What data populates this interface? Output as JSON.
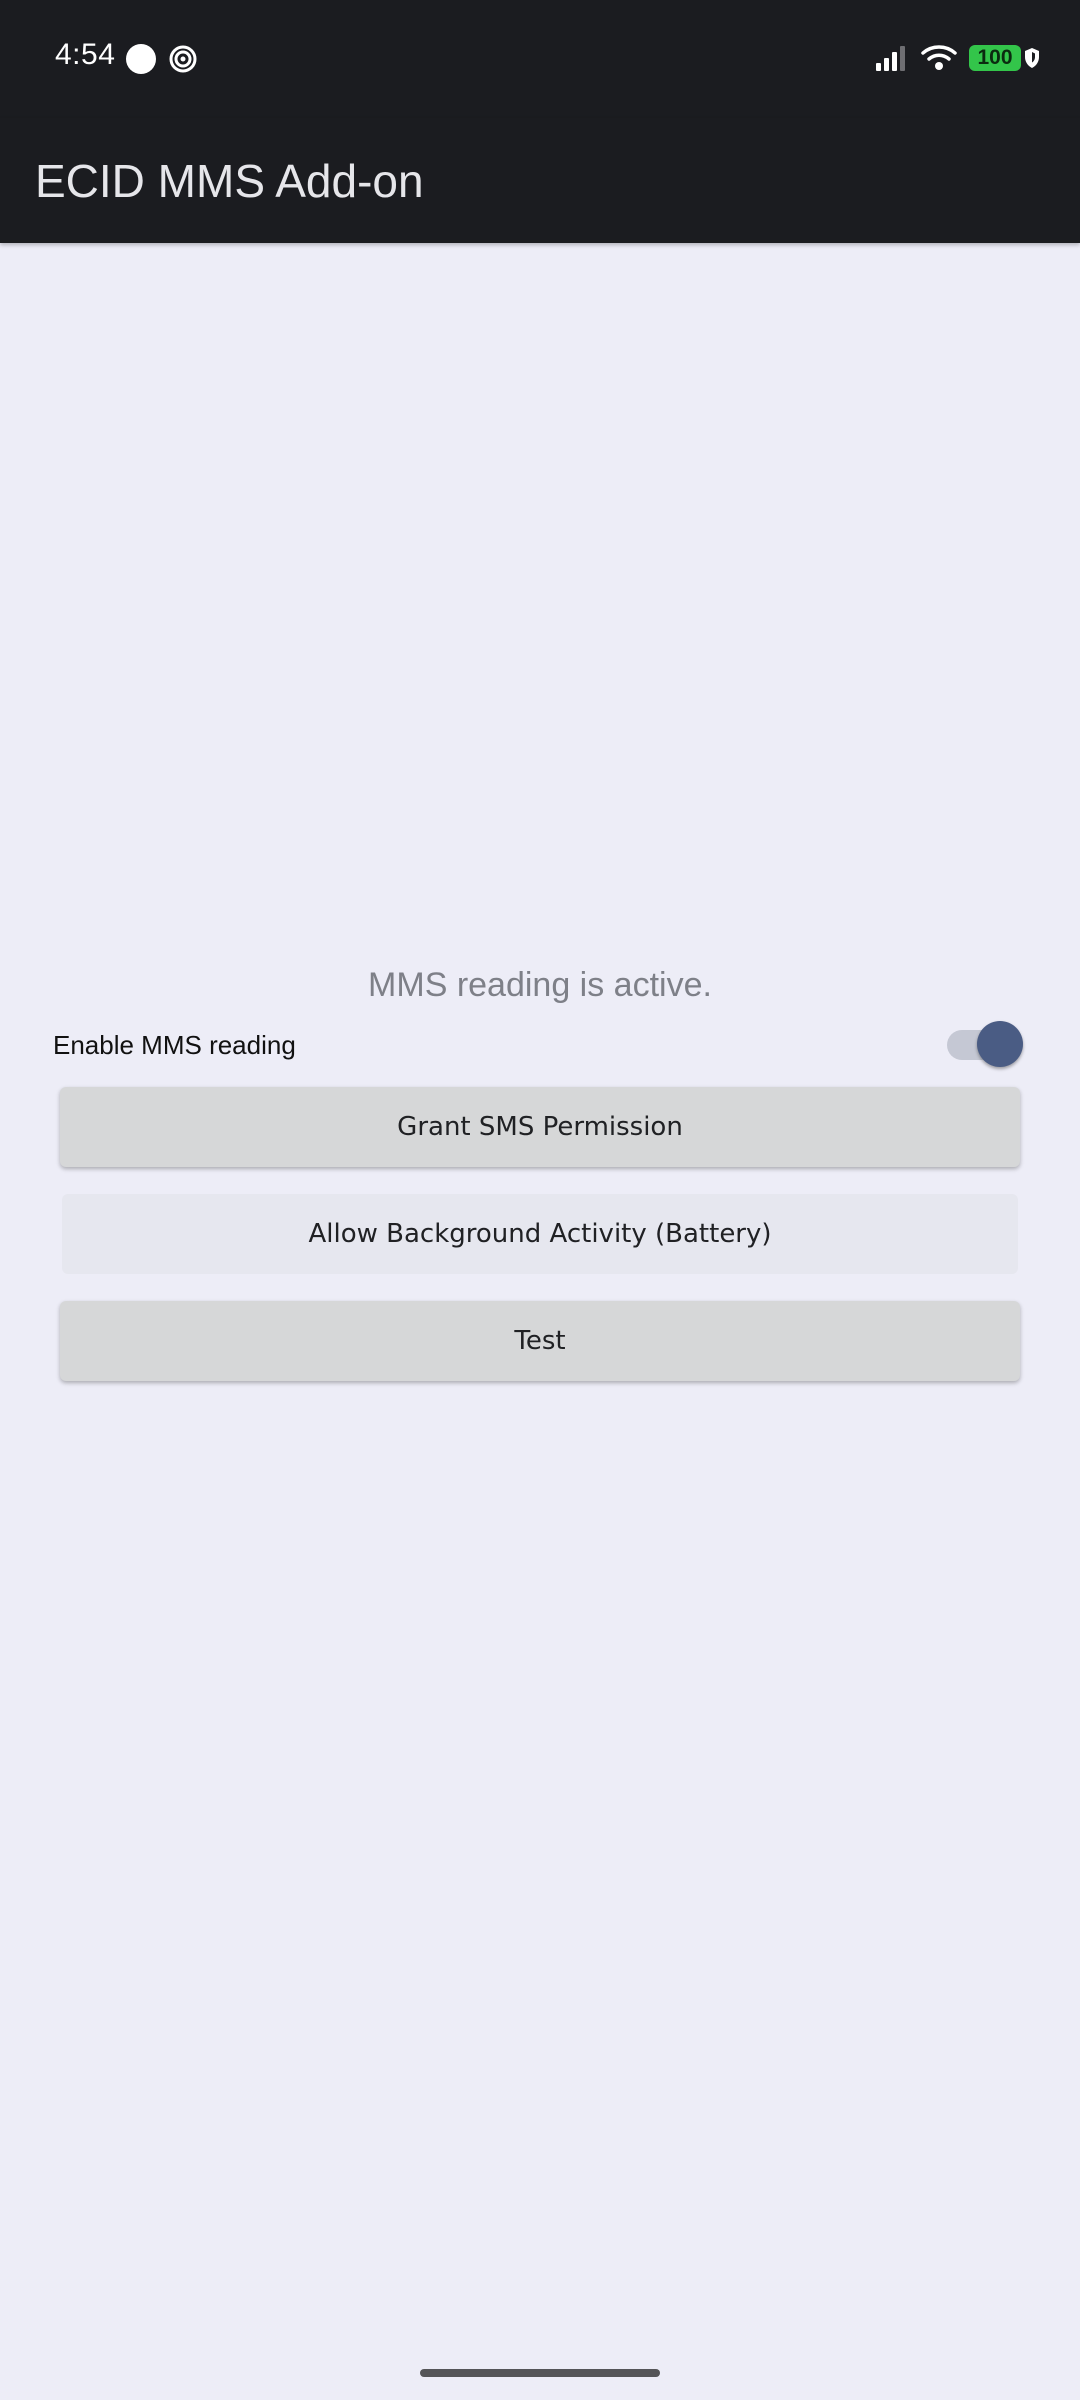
{
  "status_bar": {
    "time": "4:54",
    "battery_level": "100",
    "icons": [
      "circle-notification-icon",
      "target-icon",
      "signal-icon",
      "wifi-icon",
      "battery-icon",
      "shield-icon"
    ],
    "battery_color": "#33C54A"
  },
  "app_bar": {
    "title": "ECID MMS Add-on",
    "background": "#1B1C20"
  },
  "main": {
    "status_message": "MMS reading is active.",
    "toggle": {
      "label": "Enable MMS reading",
      "checked": true,
      "accent_color": "#4A5C84"
    },
    "buttons": {
      "grant_sms": "Grant SMS Permission",
      "allow_background": "Allow Background Activity (Battery)",
      "test": "Test"
    }
  }
}
